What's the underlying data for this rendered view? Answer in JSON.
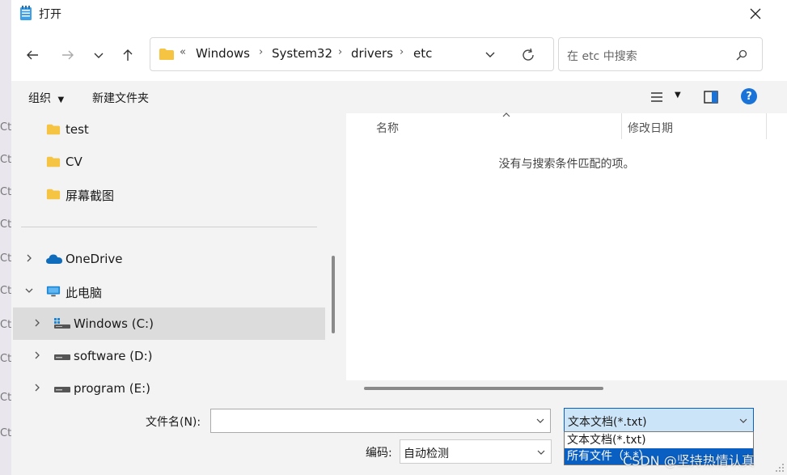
{
  "window": {
    "title": "打开"
  },
  "background_hints": [
    "Ctr",
    "Ctr",
    "Ctr",
    "Ctr",
    "Ctr",
    "Ctr",
    "Ctr",
    "Ctr",
    "Ctr",
    "Ctr"
  ],
  "navigation": {
    "breadcrumb_overflow": "«",
    "breadcrumbs": [
      "Windows",
      "System32",
      "drivers",
      "etc"
    ],
    "search_placeholder": "在 etc 中搜索"
  },
  "commandbar": {
    "organize_label": "组织",
    "new_folder_label": "新建文件夹"
  },
  "sidebar": {
    "items": [
      {
        "label": "test",
        "icon": "folder-icon",
        "expandable": false
      },
      {
        "label": "CV",
        "icon": "folder-icon",
        "expandable": false
      },
      {
        "label": "屏幕截图",
        "icon": "folder-icon",
        "expandable": false
      },
      {
        "label": "OneDrive",
        "icon": "cloud-icon",
        "expandable": true,
        "expanded": false
      },
      {
        "label": "此电脑",
        "icon": "computer-icon",
        "expandable": true,
        "expanded": true
      },
      {
        "label": "Windows (C:)",
        "icon": "windows-drive-icon",
        "expandable": true,
        "expanded": false,
        "selected": true
      },
      {
        "label": "software (D:)",
        "icon": "drive-icon",
        "expandable": true,
        "expanded": false
      },
      {
        "label": "program (E:)",
        "icon": "drive-icon",
        "expandable": true,
        "expanded": false
      }
    ]
  },
  "filelist": {
    "columns": [
      "名称",
      "修改日期"
    ],
    "empty_message": "没有与搜索条件匹配的项。"
  },
  "footer": {
    "filename_label": "文件名(N):",
    "filename_value": "",
    "filetype_selected": "文本文档(*.txt)",
    "filetype_options": [
      "文本文档(*.txt)",
      "所有文件（*.*）"
    ],
    "encoding_label": "编码:",
    "encoding_value": "自动检测"
  },
  "watermark": "CSDN @坚持热情认真",
  "colors": {
    "accent": "#0a60c2",
    "selection_fill": "#cce4f7",
    "folder_yellow": "#f6c443",
    "help_blue": "#1a73d8"
  }
}
